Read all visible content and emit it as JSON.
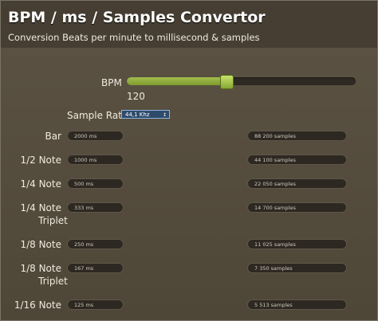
{
  "header": {
    "title": "BPM / ms / Samples Convertor",
    "subtitle": "Conversion Beats per minute to millisecond & samples"
  },
  "bpm": {
    "label": "BPM",
    "value": "120",
    "slider_fraction": 0.435
  },
  "sample_rate": {
    "label": "Sample Rate*",
    "selected": "44,1 Khz"
  },
  "rows": [
    {
      "label": "Bar",
      "label2": "",
      "ms": "2000 ms",
      "samples": "88 200 samples"
    },
    {
      "label": "1/2 Note",
      "label2": "",
      "ms": "1000 ms",
      "samples": "44 100 samples"
    },
    {
      "label": "1/4 Note",
      "label2": "",
      "ms": "500 ms",
      "samples": "22 050 samples"
    },
    {
      "label": "1/4 Note",
      "label2": "Triplet",
      "ms": "333 ms",
      "samples": "14 700 samples"
    },
    {
      "label": "1/8 Note",
      "label2": "",
      "ms": "250 ms",
      "samples": "11 025 samples"
    },
    {
      "label": "1/8 Note",
      "label2": "Triplet",
      "ms": "167 ms",
      "samples": "7 350 samples"
    },
    {
      "label": "1/16 Note",
      "label2": "",
      "ms": "125 ms",
      "samples": "5 513 samples"
    }
  ],
  "colors": {
    "accent": "#8fae35",
    "background": "#5a5142",
    "select_border": "#8eb6e0"
  }
}
